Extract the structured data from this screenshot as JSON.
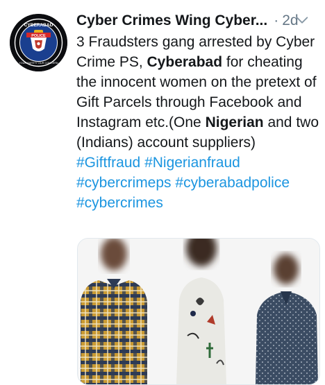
{
  "tweet": {
    "author": {
      "display_name": "Cyber Crimes Wing Cyber...",
      "avatar_text_top": "CYBERABAD",
      "avatar_text_bottom": "POLICE",
      "avatar_ring_text": "YOUR SAFETY OUR CONCERN"
    },
    "separator": "·",
    "time": "2d",
    "text": {
      "seg1": "3 Fraudsters gang arrested by Cyber Crime PS, ",
      "bold1": "Cyberabad",
      "seg2": " for cheating the innocent women on the pretext of Gift Parcels through Facebook and Instagram etc.(One ",
      "bold2": "Nigerian",
      "seg3": " and two (Indians) account suppliers)"
    },
    "hashtags": [
      "#Giftfraud",
      "#Nigerianfraud",
      "#cybercrimeps",
      "#cyberabadpolice",
      "#cybercrimes"
    ],
    "colors": {
      "link": "#1b95e0",
      "text": "#14171a",
      "muted": "#657786"
    },
    "icons": {
      "more": "chevron-down-icon"
    }
  }
}
